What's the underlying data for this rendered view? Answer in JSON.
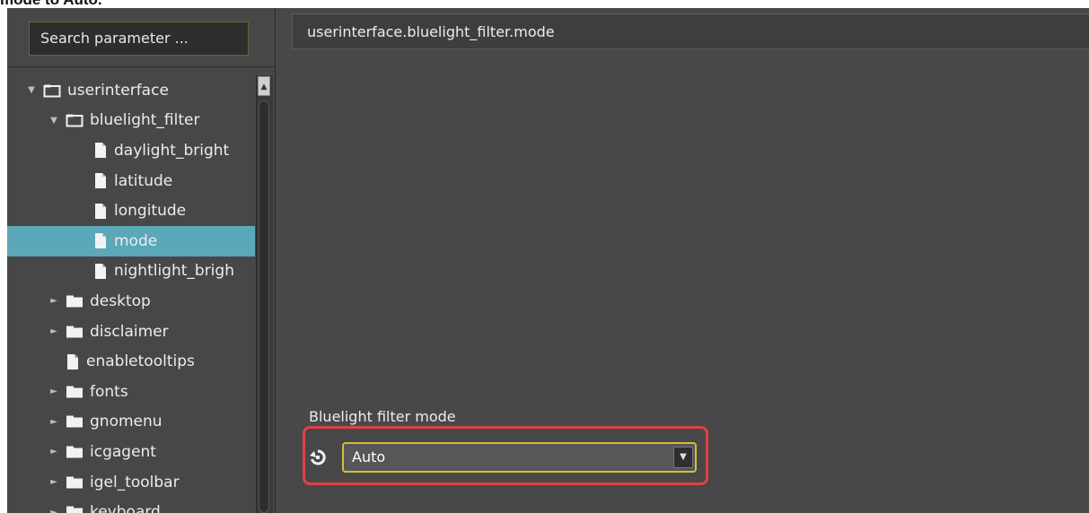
{
  "caption": "mode to Auto.",
  "search": {
    "placeholder": "Search parameter ..."
  },
  "tree": [
    {
      "label": "userinterface",
      "level": 0,
      "type": "folder-open",
      "expander": "expanded"
    },
    {
      "label": "bluelight_filter",
      "level": 1,
      "type": "folder-open",
      "expander": "expanded"
    },
    {
      "label": "daylight_bright",
      "level": 2,
      "type": "file",
      "expander": "none"
    },
    {
      "label": "latitude",
      "level": 2,
      "type": "file",
      "expander": "none"
    },
    {
      "label": "longitude",
      "level": 2,
      "type": "file",
      "expander": "none"
    },
    {
      "label": "mode",
      "level": 2,
      "type": "file",
      "expander": "none",
      "selected": true
    },
    {
      "label": "nightlight_brigh",
      "level": 2,
      "type": "file",
      "expander": "none"
    },
    {
      "label": "desktop",
      "level": 1,
      "type": "folder",
      "expander": "collapsed"
    },
    {
      "label": "disclaimer",
      "level": 1,
      "type": "folder",
      "expander": "collapsed"
    },
    {
      "label": "enabletooltips",
      "level": 1,
      "type": "file",
      "expander": "none"
    },
    {
      "label": "fonts",
      "level": 1,
      "type": "folder",
      "expander": "collapsed"
    },
    {
      "label": "gnomenu",
      "level": 1,
      "type": "folder",
      "expander": "collapsed"
    },
    {
      "label": "icgagent",
      "level": 1,
      "type": "folder",
      "expander": "collapsed"
    },
    {
      "label": "igel_toolbar",
      "level": 1,
      "type": "folder",
      "expander": "collapsed"
    },
    {
      "label": "keyboard",
      "level": 1,
      "type": "folder",
      "expander": "collapsed"
    }
  ],
  "detail": {
    "path": "userinterface.bluelight_filter.mode",
    "param_label": "Bluelight filter mode",
    "select_value": "Auto"
  },
  "colors": {
    "selection": "#5aa8b8",
    "highlight_border": "#e0404a",
    "focus_border": "#d8bd3a"
  },
  "icons": {
    "folder_open": "folder-outline-icon",
    "folder": "folder-icon",
    "file": "file-icon",
    "reset": "reset-icon"
  }
}
